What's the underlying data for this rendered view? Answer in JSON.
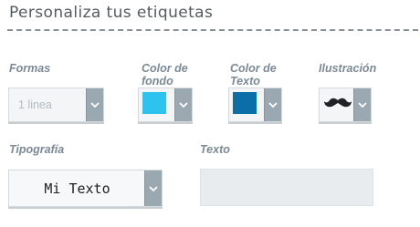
{
  "title": "Personaliza tus etiquetas",
  "fields": {
    "formas": {
      "label": "Formas",
      "value": "1 linea"
    },
    "color_fondo": {
      "label": "Color de fondo",
      "color": "#2ec3ef"
    },
    "color_texto": {
      "label": "Color de Texto",
      "color": "#0a6fa6"
    },
    "ilustracion": {
      "label": "Ilustración",
      "icon": "mustache-icon"
    },
    "tipografia": {
      "label": "Tipografía",
      "value": "Mi Texto"
    },
    "texto": {
      "label": "Texto",
      "value": ""
    }
  },
  "colors": {
    "label": "#7b8a96",
    "arrow_bg": "#9aa8b2",
    "select_bg": "#f3f5f6",
    "input_bg": "#e8ecee"
  }
}
